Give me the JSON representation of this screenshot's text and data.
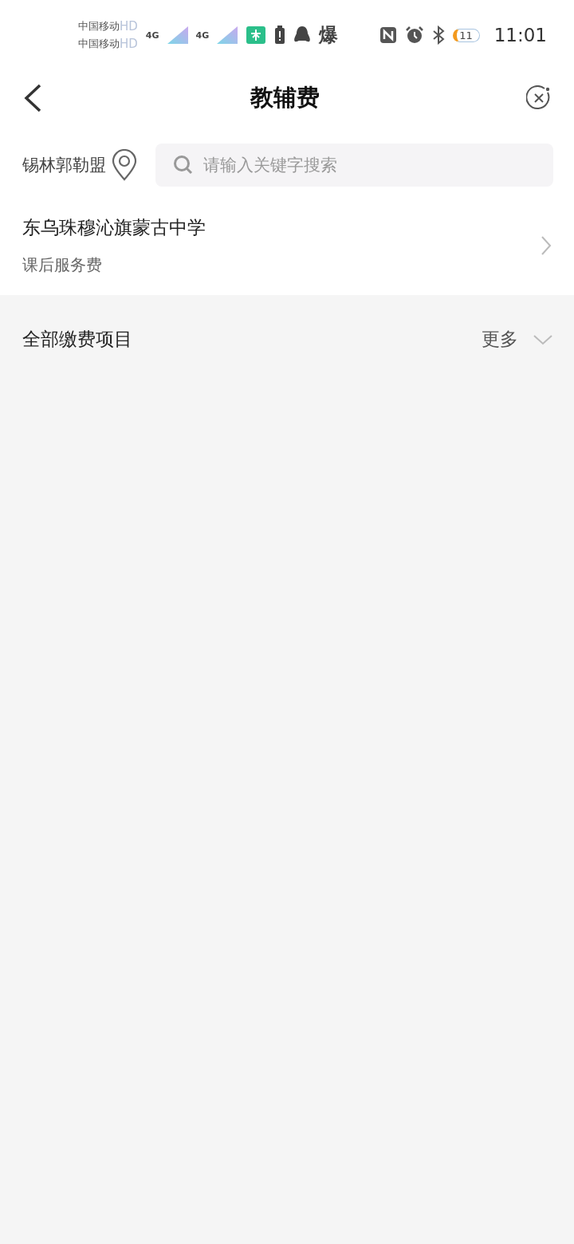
{
  "status_bar": {
    "carriers": [
      {
        "name": "中国移动",
        "badge": "HD"
      },
      {
        "name": "中国移动",
        "badge": "HD"
      }
    ],
    "networks": [
      "4G",
      "4G"
    ],
    "notice_glyph": "爆",
    "battery": "11",
    "time": "11:01"
  },
  "nav": {
    "title": "教辅费"
  },
  "search": {
    "region": "锡林郭勒盟",
    "placeholder": "请输入关键字搜索"
  },
  "school": {
    "name": "东乌珠穆沁旗蒙古中学",
    "subtitle": "课后服务费"
  },
  "section": {
    "title": "全部缴费项目",
    "more": "更多"
  }
}
